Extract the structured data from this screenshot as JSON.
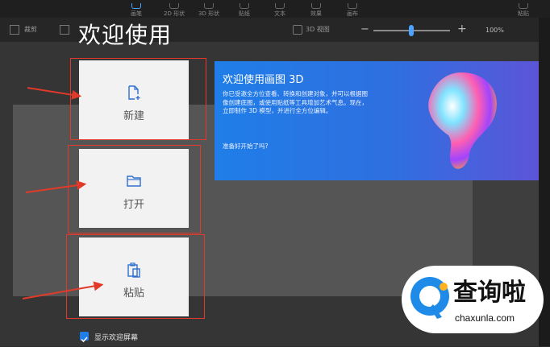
{
  "toolbar": {
    "tools": [
      {
        "label": "画笔",
        "active": true
      },
      {
        "label": "2D 形状",
        "active": false
      },
      {
        "label": "3D 形状",
        "active": false
      },
      {
        "label": "贴纸",
        "active": false
      },
      {
        "label": "文本",
        "active": false
      },
      {
        "label": "效果",
        "active": false
      },
      {
        "label": "画布",
        "active": false
      }
    ],
    "paste_label": "粘贴"
  },
  "subbar": {
    "select_label": "裁剪",
    "view_label": "3D 视图",
    "zoom": "100%"
  },
  "welcome": {
    "title": "欢迎使用",
    "cards": [
      {
        "label": "新建",
        "icon": "new-file-icon"
      },
      {
        "label": "打开",
        "icon": "folder-icon"
      },
      {
        "label": "粘贴",
        "icon": "clipboard-icon"
      }
    ]
  },
  "promo": {
    "title": "欢迎使用画图 3D",
    "body": "你已受邀全方位查看、转换和创建对象，并可以根据图像创建底图，或使用贴纸等工具增加艺术气息。现在，立即制作 3D 模型，并进行全方位编辑。",
    "question": "准备好开始了吗?"
  },
  "startup": {
    "checkbox_label": "显示欢迎屏幕",
    "checked": true
  },
  "watermark": {
    "brand": "查询啦",
    "url": "chaxunla.com"
  },
  "colors": {
    "annotation_red": "#e23a2a",
    "accent_blue": "#1f7ee8"
  }
}
